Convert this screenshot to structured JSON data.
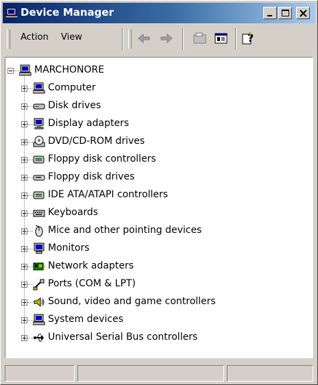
{
  "window": {
    "title": "Device Manager"
  },
  "menu": {
    "action_label": "Action",
    "view_label": "View"
  },
  "tree": {
    "root_label": "MARCHONORE",
    "items": [
      {
        "label": "Computer",
        "icon": "computer-icon"
      },
      {
        "label": "Disk drives",
        "icon": "disk-drive-icon"
      },
      {
        "label": "Display adapters",
        "icon": "display-adapter-icon"
      },
      {
        "label": "DVD/CD-ROM drives",
        "icon": "cdrom-icon"
      },
      {
        "label": "Floppy disk controllers",
        "icon": "controller-icon"
      },
      {
        "label": "Floppy disk drives",
        "icon": "floppy-drive-icon"
      },
      {
        "label": "IDE ATA/ATAPI controllers",
        "icon": "controller-icon"
      },
      {
        "label": "Keyboards",
        "icon": "keyboard-icon"
      },
      {
        "label": "Mice and other pointing devices",
        "icon": "mouse-icon"
      },
      {
        "label": "Monitors",
        "icon": "monitor-icon"
      },
      {
        "label": "Network adapters",
        "icon": "network-adapter-icon"
      },
      {
        "label": "Ports (COM & LPT)",
        "icon": "port-icon"
      },
      {
        "label": "Sound, video and game controllers",
        "icon": "sound-icon"
      },
      {
        "label": "System devices",
        "icon": "system-devices-icon"
      },
      {
        "label": "Universal Serial Bus controllers",
        "icon": "usb-icon"
      }
    ]
  },
  "colors": {
    "title_gradient_start": "#0a246a",
    "title_gradient_end": "#a6caf0",
    "face": "#d4d0c8"
  }
}
